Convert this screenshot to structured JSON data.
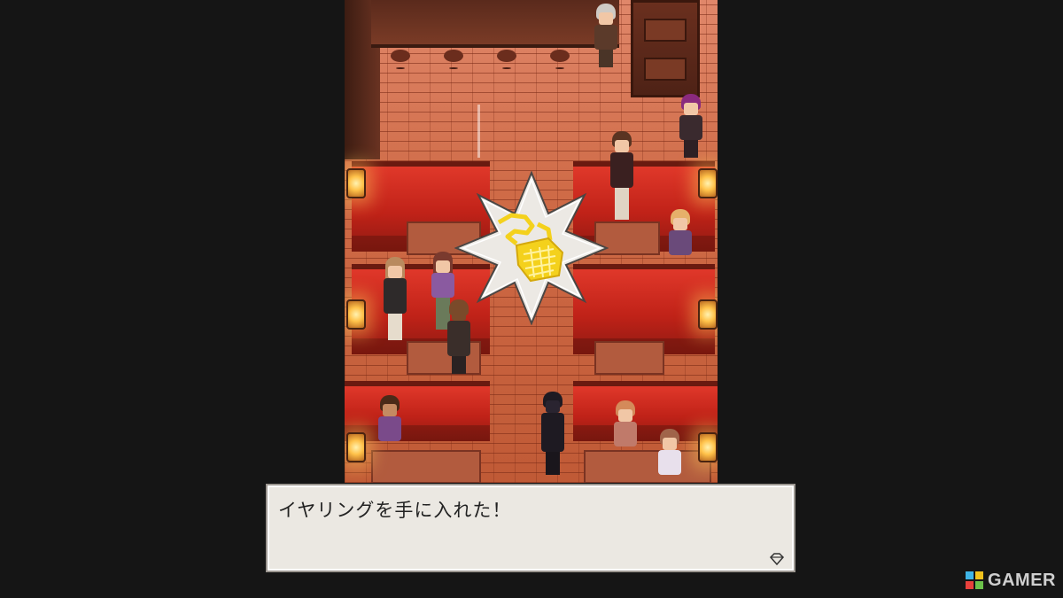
{
  "game": {
    "scene": "bar interior",
    "dialog": {
      "message": "イヤリングを手に入れた！",
      "advance_icon": "diamond-outline-icon"
    },
    "obtained_item": {
      "name": "イヤリング",
      "icon": "golden-earring-icon",
      "frame": "eight-point-star"
    }
  },
  "watermark": {
    "brand": "GAMER",
    "logo": "gamer-g-logo"
  },
  "colors": {
    "letterbox": "#151515",
    "brick": "#c4613d",
    "booth_red": "#d42c20",
    "dialog_bg": "#ebe8e2",
    "dialog_border": "#9b9690",
    "item_gold": "#f4d11c",
    "watermark_text": "#cfcfcf"
  }
}
